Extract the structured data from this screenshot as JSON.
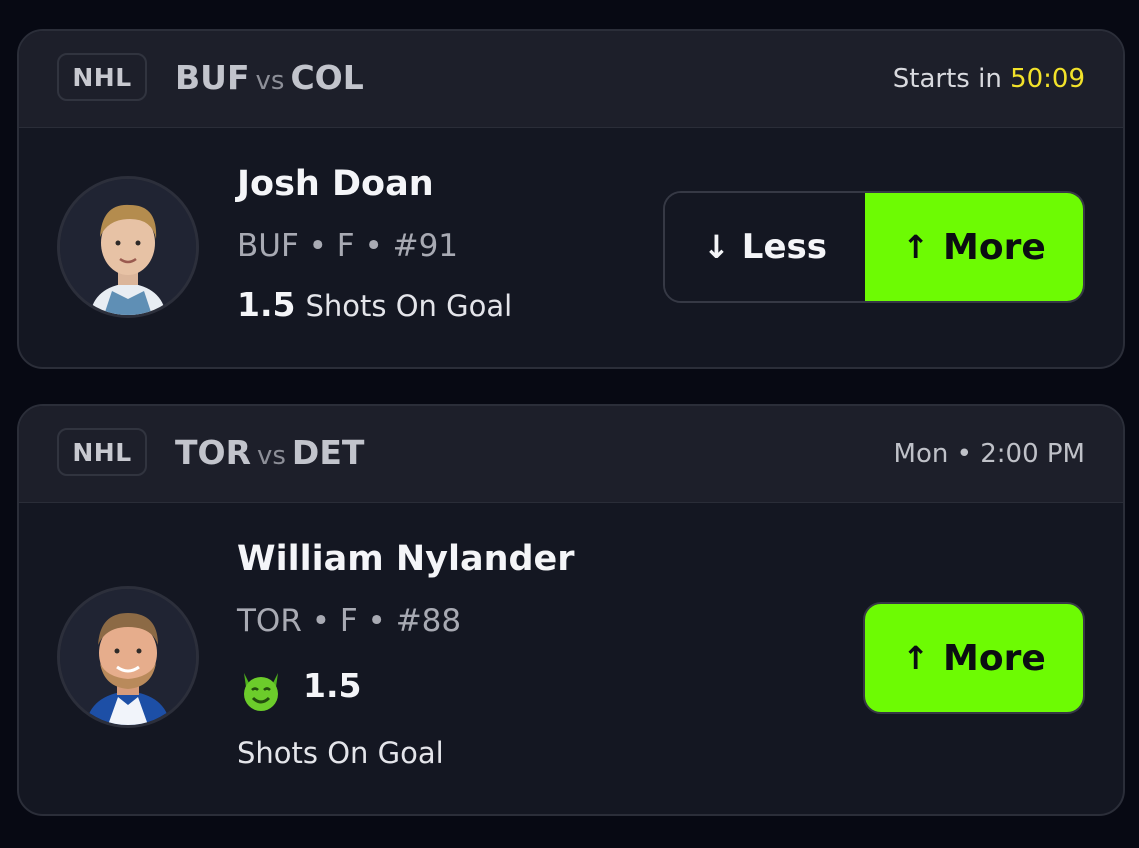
{
  "cards": [
    {
      "league": "NHL",
      "team_a": "BUF",
      "vs": "vs",
      "team_b": "COL",
      "start_prefix": "Starts in",
      "start_timer": "50:09",
      "player_name": "Josh Doan",
      "player_meta": "BUF • F • #91",
      "line_value": "1.5",
      "stat_type": "Shots On Goal",
      "less_label": "Less",
      "more_label": "More"
    },
    {
      "league": "NHL",
      "team_a": "TOR",
      "vs": "vs",
      "team_b": "DET",
      "start_time": "Mon • 2:00 PM",
      "player_name": "William Nylander",
      "player_meta": "TOR • F • #88",
      "line_value": "1.5",
      "stat_type": "Shots On Goal",
      "more_label": "More"
    }
  ],
  "icons": {
    "less": "arrow-down-icon",
    "more": "arrow-up-icon",
    "modifier": "demon-emoji-icon"
  },
  "colors": {
    "background": "#070913",
    "card": "#141722",
    "header": "#1d1f2a",
    "accent_green": "#6dfb03",
    "timer_yellow": "#f2e22a"
  }
}
